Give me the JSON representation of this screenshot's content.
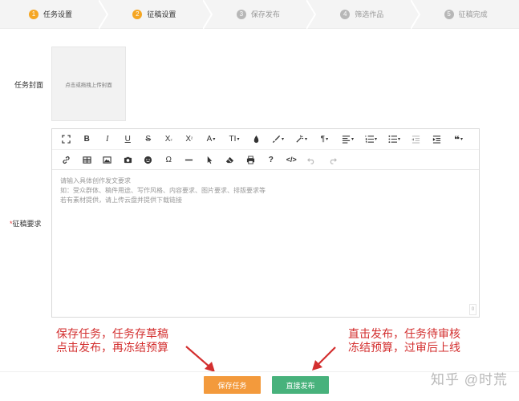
{
  "steps": [
    {
      "num": "1",
      "label": "任务设置",
      "state": "done"
    },
    {
      "num": "2",
      "label": "征稿设置",
      "state": "active"
    },
    {
      "num": "3",
      "label": "保存发布",
      "state": "todo"
    },
    {
      "num": "4",
      "label": "筛选作品",
      "state": "todo"
    },
    {
      "num": "5",
      "label": "征稿完成",
      "state": "todo"
    }
  ],
  "form": {
    "cover_label": "任务封面",
    "cover_placeholder": "点击或拖拽上传封面",
    "req_asterisk": "*",
    "req_label": "征稿要求"
  },
  "editor": {
    "placeholder_lines": [
      "请输入具体创作发文要求",
      "如：受众群体、稿件用途、写作风格、内容要求、图片要求、排版要求等",
      "若有素材提供，请上传云盘并提供下载链接"
    ],
    "char_count": "0",
    "toolbar_row1": [
      "fullscreen-icon",
      "bold-icon",
      "italic-icon",
      "underline-icon",
      "strikethrough-icon",
      "subscript-icon",
      "superscript-icon",
      "font-size-icon",
      "text-height-icon",
      "text-color-icon",
      "background-color-icon",
      "brush-icon",
      "paragraph-icon",
      "align-icon",
      "ordered-list-icon",
      "unordered-list-icon",
      "outdent-icon",
      "indent-icon",
      "quote-icon"
    ],
    "toolbar_row2": [
      "link-icon",
      "table-icon",
      "image-icon",
      "camera-icon",
      "emoji-icon",
      "special-char-icon",
      "horizontal-line-icon",
      "select-icon",
      "clear-format-icon",
      "print-icon",
      "help-icon",
      "code-view-icon",
      "undo-icon",
      "redo-icon"
    ]
  },
  "annotations": {
    "left": [
      "保存任务，任务存草稿",
      "点击发布，再冻结预算"
    ],
    "right": [
      "直击发布，任务待审核",
      "冻结预算，过审后上线"
    ]
  },
  "buttons": {
    "save": "保存任务",
    "publish": "直接发布"
  },
  "watermark": "知乎 @时荒",
  "colors": {
    "accent": "#f5a623",
    "save": "#f39a3c",
    "publish": "#48b27c",
    "annotation": "#d32f2f"
  }
}
